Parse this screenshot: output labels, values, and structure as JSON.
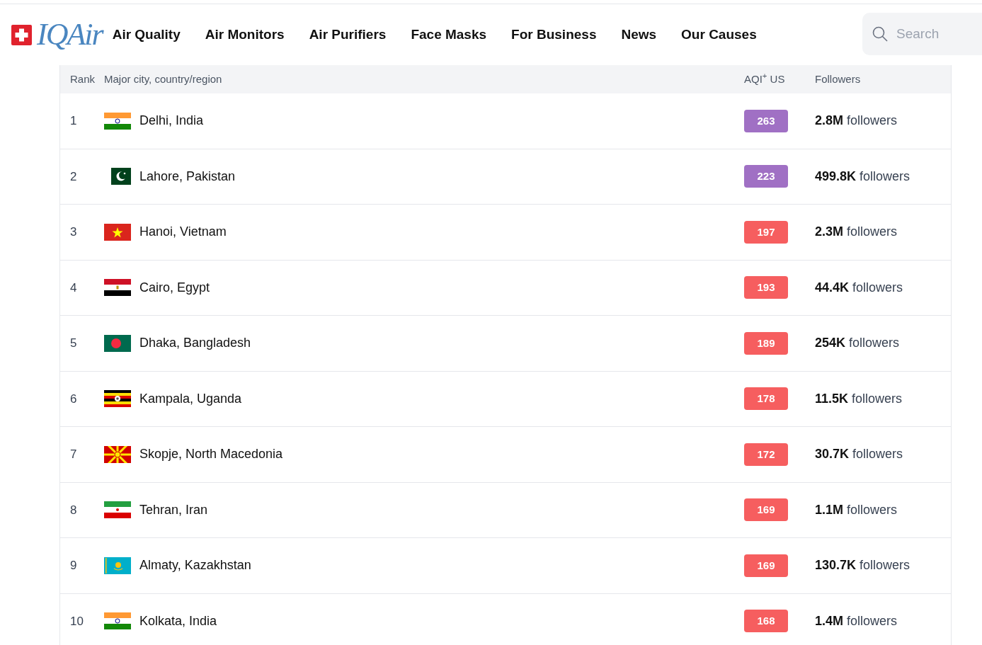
{
  "logo": {
    "text": "IQAir"
  },
  "nav": [
    "Air Quality",
    "Air Monitors",
    "Air Purifiers",
    "Face Masks",
    "For Business",
    "News",
    "Our Causes"
  ],
  "search": {
    "placeholder": "Search"
  },
  "table": {
    "columns": [
      "Rank",
      "Major city, country/region",
      "AQI$^{+}$ US",
      "Followers"
    ],
    "rows": [
      {
        "rank": "1",
        "kind": "india",
        "city": "Delhi, India",
        "aqi": "263",
        "color": "#a070c4",
        "followers": "**2.8M** followers"
      },
      {
        "rank": "2",
        "kind": "pakistan",
        "city": "Lahore, Pakistan",
        "aqi": "223",
        "color": "#a070c4",
        "followers": "**499.8K** followers"
      },
      {
        "rank": "3",
        "kind": "vietnam",
        "city": "Hanoi, Vietnam",
        "aqi": "197",
        "color": "#f65e5f",
        "followers": "**2.3M** followers"
      },
      {
        "rank": "4",
        "kind": "egypt",
        "city": "Cairo, Egypt",
        "aqi": "193",
        "color": "#f65e5f",
        "followers": "**44.4K** followers"
      },
      {
        "rank": "5",
        "kind": "bangladesh",
        "city": "Dhaka, Bangladesh",
        "aqi": "189",
        "color": "#f65e5f",
        "followers": "**254K** followers"
      },
      {
        "rank": "6",
        "kind": "uganda",
        "city": "Kampala, Uganda",
        "aqi": "178",
        "color": "#f65e5f",
        "followers": "**11.5K** followers"
      },
      {
        "rank": "7",
        "kind": "macedonia",
        "city": "Skopje, North Macedonia",
        "aqi": "172",
        "color": "#f65e5f",
        "followers": "**30.7K** followers"
      },
      {
        "rank": "8",
        "kind": "iran",
        "city": "Tehran, Iran",
        "aqi": "169",
        "color": "#f65e5f",
        "followers": "**1.1M** followers"
      },
      {
        "rank": "9",
        "kind": "kazakhstan",
        "city": "Almaty, Kazakhstan",
        "aqi": "169",
        "color": "#f65e5f",
        "followers": "**130.7K** followers"
      },
      {
        "rank": "10",
        "kind": "india",
        "city": "Kolkata, India",
        "aqi": "168",
        "color": "#f65e5f",
        "followers": "**1.4M** followers"
      }
    ]
  }
}
